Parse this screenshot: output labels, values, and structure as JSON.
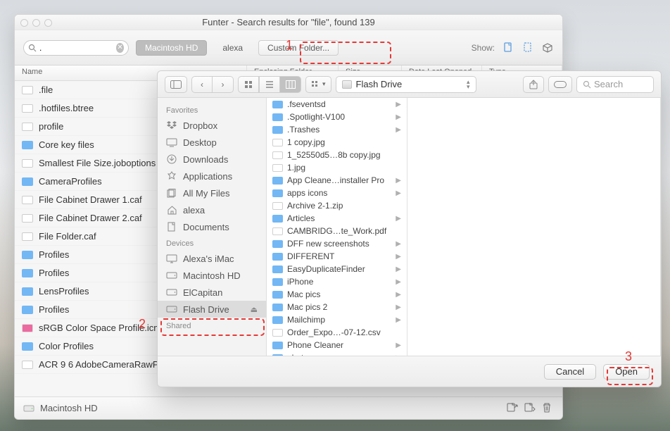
{
  "main_window": {
    "title": "Funter - Search results for \"file\", found 139",
    "search_value": ".",
    "scope_buttons": [
      "Macintosh HD",
      "alexa",
      "Custom Folder..."
    ],
    "show_label": "Show:",
    "columns": [
      "Name",
      "Enclosing Folder",
      "Size",
      "Date Last Opened",
      "Type"
    ],
    "files": [
      {
        "icon": "doc",
        "name": ".file"
      },
      {
        "icon": "doc",
        "name": ".hotfiles.btree"
      },
      {
        "icon": "doc",
        "name": "profile"
      },
      {
        "icon": "fold",
        "name": "Core key files"
      },
      {
        "icon": "doc",
        "name": "Smallest File Size.joboptions"
      },
      {
        "icon": "fold",
        "name": "CameraProfiles"
      },
      {
        "icon": "doc",
        "name": "File Cabinet Drawer 1.caf"
      },
      {
        "icon": "doc",
        "name": "File Cabinet Drawer 2.caf"
      },
      {
        "icon": "doc",
        "name": "File Folder.caf"
      },
      {
        "icon": "fold",
        "name": "Profiles"
      },
      {
        "icon": "fold",
        "name": "Profiles"
      },
      {
        "icon": "fold",
        "name": "LensProfiles"
      },
      {
        "icon": "fold",
        "name": "Profiles"
      },
      {
        "icon": "pink",
        "name": "sRGB Color Space Profile.icm"
      },
      {
        "icon": "fold",
        "name": "Color Profiles"
      },
      {
        "icon": "doc",
        "name": "ACR 9 6 AdobeCameraRawP"
      }
    ],
    "status_location": "Macintosh HD"
  },
  "open_panel": {
    "location": "Flash Drive",
    "search_placeholder": "Search",
    "sidebar": {
      "favorites_label": "Favorites",
      "favorites": [
        {
          "icon": "dropbox",
          "label": "Dropbox"
        },
        {
          "icon": "desktop",
          "label": "Desktop"
        },
        {
          "icon": "downloads",
          "label": "Downloads"
        },
        {
          "icon": "applications",
          "label": "Applications"
        },
        {
          "icon": "all-my-files",
          "label": "All My Files"
        },
        {
          "icon": "home",
          "label": "alexa"
        },
        {
          "icon": "documents",
          "label": "Documents"
        }
      ],
      "devices_label": "Devices",
      "devices": [
        {
          "icon": "imac",
          "label": "Alexa's iMac"
        },
        {
          "icon": "hd",
          "label": "Macintosh HD"
        },
        {
          "icon": "hd",
          "label": "ElCapitan"
        },
        {
          "icon": "hd",
          "label": "Flash Drive",
          "selected": true,
          "eject": true
        }
      ],
      "shared_label": "Shared"
    },
    "column_items": [
      {
        "icon": "fold",
        "name": ".fseventsd",
        "arrow": true
      },
      {
        "icon": "fold",
        "name": ".Spotlight-V100",
        "arrow": true
      },
      {
        "icon": "fold",
        "name": ".Trashes",
        "arrow": true
      },
      {
        "icon": "doc",
        "name": "1 copy.jpg"
      },
      {
        "icon": "doc",
        "name": "1_52550d5…8b copy.jpg"
      },
      {
        "icon": "doc",
        "name": "1.jpg"
      },
      {
        "icon": "fold",
        "name": "App Cleane…installer Pro",
        "arrow": true
      },
      {
        "icon": "fold",
        "name": "apps icons",
        "arrow": true
      },
      {
        "icon": "doc",
        "name": "Archive 2-1.zip"
      },
      {
        "icon": "fold",
        "name": "Articles",
        "arrow": true
      },
      {
        "icon": "doc",
        "name": "CAMBRIDG…te_Work.pdf"
      },
      {
        "icon": "fold",
        "name": "DFF new screenshots",
        "arrow": true
      },
      {
        "icon": "fold",
        "name": "DIFFERENT",
        "arrow": true
      },
      {
        "icon": "fold",
        "name": "EasyDuplicateFinder",
        "arrow": true
      },
      {
        "icon": "fold",
        "name": "iPhone",
        "arrow": true
      },
      {
        "icon": "fold",
        "name": "Mac pics",
        "arrow": true
      },
      {
        "icon": "fold",
        "name": "Mac pics 2",
        "arrow": true
      },
      {
        "icon": "fold",
        "name": "Mailchimp",
        "arrow": true
      },
      {
        "icon": "doc",
        "name": "Order_Expo…-07-12.csv"
      },
      {
        "icon": "fold",
        "name": "Phone Cleaner",
        "arrow": true
      },
      {
        "icon": "fold",
        "name": "photos",
        "arrow": true
      }
    ],
    "cancel_label": "Cancel",
    "open_label": "Open"
  },
  "annotations": {
    "one": "1",
    "two": "2",
    "three": "3"
  }
}
